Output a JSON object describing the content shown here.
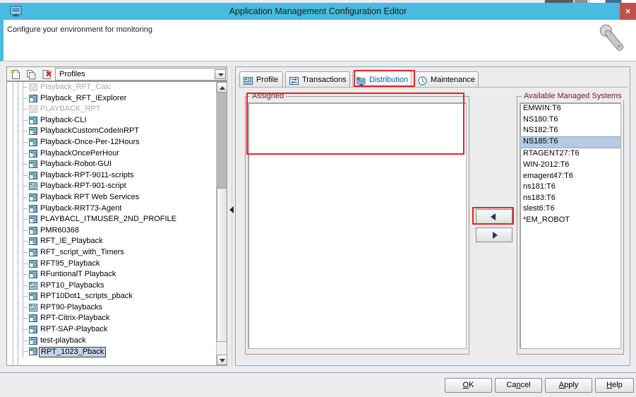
{
  "window": {
    "title": "Application Management Configuration Editor",
    "icon": "monitor-icon",
    "close_label": "×",
    "titlebar_color": "#45bce0",
    "close_color": "#c0504d"
  },
  "header": {
    "subtitle": "Configure your environment for monitoring",
    "icon": "wrench-icon"
  },
  "left_panel": {
    "toolbar": {
      "new_label": "new-profile-icon",
      "copy_label": "copy-profile-icon",
      "delete_label": "delete-profile-icon"
    },
    "combo": {
      "value": "Profiles",
      "arrow": "chevron-down-icon"
    },
    "tree_items": [
      {
        "label": "Playback_RFT_Calc",
        "state": "disabled",
        "icon": "script-icon"
      },
      {
        "label": "Playback_RFT_IExplorer",
        "state": "normal",
        "icon": "profile-icon"
      },
      {
        "label": "PLAYBACK_RPT",
        "state": "disabled",
        "icon": "script-icon"
      },
      {
        "label": "Playback-CLI",
        "state": "normal",
        "icon": "profile-icon"
      },
      {
        "label": "PlaybackCustomCodeInRPT",
        "state": "normal",
        "icon": "profile-icon"
      },
      {
        "label": "Playback-Once-Per-12Hours",
        "state": "normal",
        "icon": "profile-icon"
      },
      {
        "label": "PlaybackOncePerHour",
        "state": "normal",
        "icon": "profile-icon"
      },
      {
        "label": "Playback-Robot-GUI",
        "state": "normal",
        "icon": "profile-icon"
      },
      {
        "label": "Playback-RPT-9011-scripts",
        "state": "normal",
        "icon": "profile-icon"
      },
      {
        "label": "Playback-RPT-901-script",
        "state": "normal",
        "icon": "script-icon"
      },
      {
        "label": "Playback RPT Web Services",
        "state": "normal",
        "icon": "profile-icon"
      },
      {
        "label": "Playback-RRT73-Agent",
        "state": "normal",
        "icon": "profile-icon"
      },
      {
        "label": "PLAYBACL_ITMUSER_2ND_PROFILE",
        "state": "normal",
        "icon": "profile-icon"
      },
      {
        "label": "PMR60368",
        "state": "normal",
        "icon": "profile-icon"
      },
      {
        "label": "RFT_IE_Playback",
        "state": "normal",
        "icon": "profile-icon"
      },
      {
        "label": "RFT_script_with_Timers",
        "state": "normal",
        "icon": "profile-icon"
      },
      {
        "label": "RFT95_Playback",
        "state": "normal",
        "icon": "profile-icon"
      },
      {
        "label": "RFuntionalT Playback",
        "state": "normal",
        "icon": "profile-icon"
      },
      {
        "label": "RPT10_Playbacks",
        "state": "normal",
        "icon": "script-icon"
      },
      {
        "label": "RPT10Dot1_scripts_pback",
        "state": "normal",
        "icon": "profile-icon"
      },
      {
        "label": "RPT90-Playbacks",
        "state": "normal",
        "icon": "script-icon"
      },
      {
        "label": "RPT-Citrix-Playback",
        "state": "normal",
        "icon": "profile-icon"
      },
      {
        "label": "RPT-SAP-Playback",
        "state": "normal",
        "icon": "profile-icon"
      },
      {
        "label": "test-playback",
        "state": "normal",
        "icon": "profile-icon"
      },
      {
        "label": "RPT_1023_Pback",
        "state": "selected",
        "icon": "profile-icon"
      }
    ]
  },
  "tabs": [
    {
      "label": "Profile",
      "icon": "profile-tab-icon",
      "active": false
    },
    {
      "label": "Transactions",
      "icon": "transactions-tab-icon",
      "active": false
    },
    {
      "label": "Distribution",
      "icon": "distribution-tab-icon",
      "active": true
    },
    {
      "label": "Maintenance",
      "icon": "maintenance-tab-icon",
      "active": false
    }
  ],
  "distribution": {
    "assigned_group_label": "Assigned",
    "assigned_items": [],
    "available_group_label": "Available Managed Systems",
    "available_items": [
      {
        "label": "EMWIN:T6",
        "selected": false
      },
      {
        "label": "NS180:T6",
        "selected": false
      },
      {
        "label": "NS182:T6",
        "selected": false
      },
      {
        "label": "NS185:T6",
        "selected": true
      },
      {
        "label": "RTAGENT27:T6",
        "selected": false
      },
      {
        "label": "WIN-2012:T6",
        "selected": false
      },
      {
        "label": "emagent47:T6",
        "selected": false
      },
      {
        "label": "ns181:T6",
        "selected": false
      },
      {
        "label": "ns183:T6",
        "selected": false
      },
      {
        "label": "slest6:T6",
        "selected": false
      },
      {
        "label": "*EM_ROBOT",
        "selected": false
      }
    ],
    "move_left_label": "left-arrow-icon",
    "move_right_label": "right-arrow-icon"
  },
  "footer": {
    "ok": {
      "pre": "",
      "mnemonic": "O",
      "post": "K"
    },
    "cancel": {
      "pre": "Ca",
      "mnemonic": "n",
      "post": "cel"
    },
    "apply": {
      "pre": "",
      "mnemonic": "A",
      "post": "pply"
    },
    "help": {
      "pre": "",
      "mnemonic": "H",
      "post": "elp"
    }
  },
  "annotations": {
    "color": "#ef2020",
    "boxes": [
      "distribution-tab",
      "assigned-list-top",
      "move-left-button"
    ]
  }
}
